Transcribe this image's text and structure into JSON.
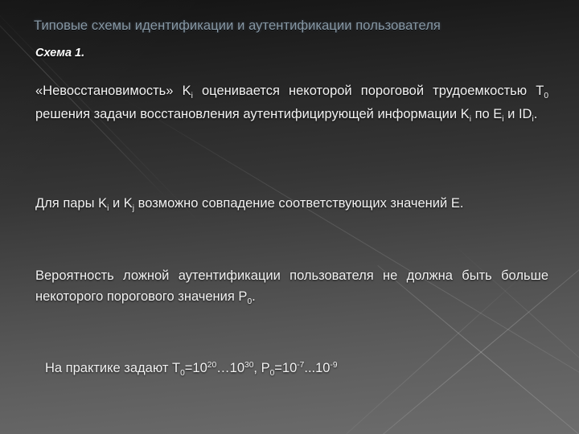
{
  "slide": {
    "title": "Типовые схемы идентификации и аутентификации пользователя",
    "subheading": "Схема 1.",
    "title_color": "#8899a6",
    "body_color": "#f2f2f2",
    "background_top_color": "#131313",
    "background_bottom_color": "#6d6d6d"
  },
  "paragraphs": [
    {
      "id": "p1",
      "segments": [
        {
          "text": "«Невосстановимость» "
        },
        {
          "text": "K",
          "sub": "i"
        },
        {
          "text": " оценивается некоторой пороговой трудоемкостью "
        },
        {
          "text": "T",
          "sub": "0"
        },
        {
          "text": " решения задачи восстановления аутентифицирующей информации "
        },
        {
          "text": "K",
          "sub": "i"
        },
        {
          "text": " по "
        },
        {
          "text": "E",
          "sub": "i"
        },
        {
          "text": " и "
        },
        {
          "text": "ID",
          "sub": "i"
        },
        {
          "text": "."
        }
      ],
      "plain": "«Невосстановимость» Ki оценивается некоторой пороговой трудоемкостью T0 решения задачи восстановления аутентифицирующей информации Ki по Ei и IDi."
    },
    {
      "id": "p2",
      "segments": [
        {
          "text": "Для пары "
        },
        {
          "text": "K",
          "sub": "i"
        },
        {
          "text": " и "
        },
        {
          "text": "K",
          "sub": "j"
        },
        {
          "text": " возможно совпадение соответствующих значений E."
        }
      ],
      "plain": "Для пары Ki и Kj возможно совпадение соответствующих значений E."
    },
    {
      "id": "p3",
      "segments": [
        {
          "text": "Вероятность ложной аутентификации пользователя не должна быть больше некоторого порогового значения "
        },
        {
          "text": "P",
          "sub": "0"
        },
        {
          "text": "."
        }
      ],
      "plain": "Вероятность ложной аутентификации пользователя не должна быть больше некоторого порогового значения P0."
    },
    {
      "id": "p4",
      "segments": [
        {
          "text": "На практике задают "
        },
        {
          "text": "T",
          "sub": "0"
        },
        {
          "text": "=10",
          "sup": "20"
        },
        {
          "text": "…10",
          "sup": "30"
        },
        {
          "text": ", "
        },
        {
          "text": "P",
          "sub": "0"
        },
        {
          "text": "=10",
          "sup": "-7"
        },
        {
          "text": "...10",
          "sup": "-9"
        }
      ],
      "plain": "На практике задают T0=1020…1030, P0=10-7...10-9"
    }
  ]
}
